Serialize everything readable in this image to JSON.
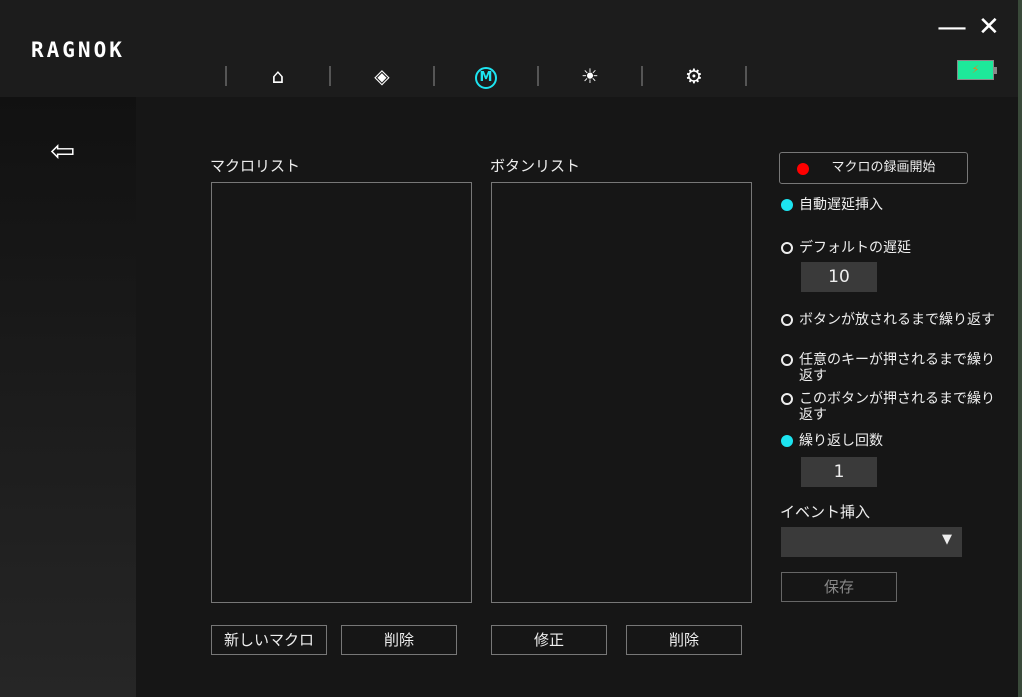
{
  "app": {
    "logo": "RAGNOK",
    "minimize": "—",
    "close": "✕",
    "battery_icon": "⚡"
  },
  "nav": [
    {
      "name": "home",
      "glyph": "⌂"
    },
    {
      "name": "dpad",
      "glyph": "◈"
    },
    {
      "name": "macro",
      "glyph": "M"
    },
    {
      "name": "lighting",
      "glyph": "☀"
    },
    {
      "name": "settings",
      "glyph": "⚙"
    }
  ],
  "sidebar": {
    "exit_glyph": "⇦"
  },
  "macro_list": {
    "title": "マクロリスト",
    "new_button": "新しいマクロ",
    "delete_button": "削除"
  },
  "button_list": {
    "title": "ボタンリスト",
    "edit_button": "修正",
    "delete_button": "削除"
  },
  "options": {
    "record_button": "マクロの録画開始",
    "auto_delay": "自動遅延挿入",
    "default_delay": "デフォルトの遅延",
    "default_delay_value": "10",
    "repeat_until_released": "ボタンが放されるまで繰り返す",
    "repeat_until_any_key": "任意のキーが押されるまで繰り返す",
    "repeat_until_this_button": "このボタンが押されるまで繰り返す",
    "repeat_count": "繰り返し回数",
    "repeat_count_value": "1",
    "event_insert": "イベント挿入",
    "save_button": "保存"
  },
  "colors": {
    "accent": "#1de4f0",
    "record": "#ff0000",
    "battery": "#1de89a"
  }
}
